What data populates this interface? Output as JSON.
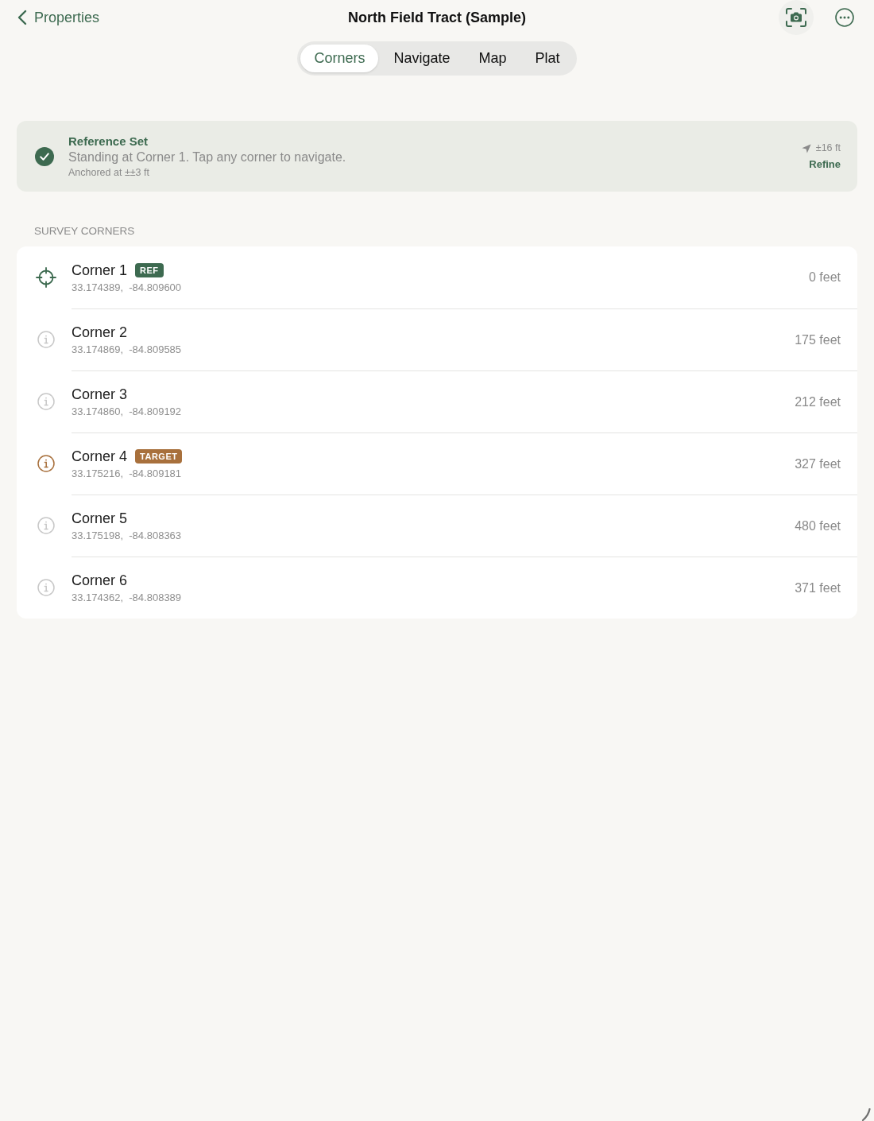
{
  "nav": {
    "back": "Properties",
    "title": "North Field Tract (Sample)"
  },
  "tabs": [
    {
      "label": "Corners",
      "selected": true
    },
    {
      "label": "Navigate",
      "selected": false
    },
    {
      "label": "Map",
      "selected": false
    },
    {
      "label": "Plat",
      "selected": false
    }
  ],
  "banner": {
    "title": "Reference Set",
    "message": "Standing at Corner 1. Tap any corner to navigate.",
    "detail": "Anchored at ±±3 ft",
    "accuracy": "±16 ft",
    "action": "Refine"
  },
  "section": {
    "title": "SURVEY CORNERS"
  },
  "corners": [
    {
      "name": "Corner 1",
      "kind": "reference",
      "badge": "REF",
      "coords": "33.174389,  -84.809600",
      "distance": "0 feet"
    },
    {
      "name": "Corner 2",
      "kind": "corner",
      "coords": "33.174869,  -84.809585",
      "distance": "175 feet"
    },
    {
      "name": "Corner 3",
      "kind": "corner",
      "coords": "33.174860,  -84.809192",
      "distance": "212 feet"
    },
    {
      "name": "Corner 4",
      "kind": "target",
      "badge": "TARGET",
      "coords": "33.175216,  -84.809181",
      "distance": "327 feet"
    },
    {
      "name": "Corner 5",
      "kind": "corner",
      "coords": "33.175198,  -84.808363",
      "distance": "480 feet"
    },
    {
      "name": "Corner 6",
      "kind": "corner",
      "coords": "33.174362,  -84.808389",
      "distance": "371 feet"
    }
  ]
}
